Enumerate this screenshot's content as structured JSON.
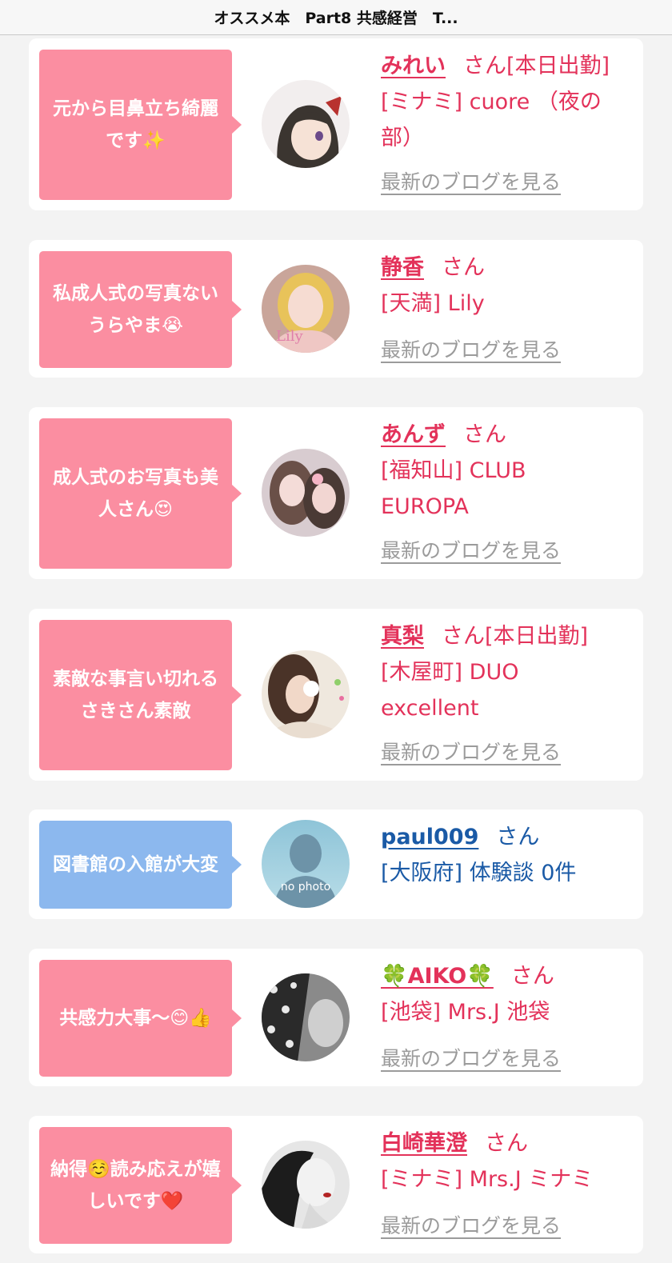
{
  "topbar": {
    "title": "オススメ本　Part8 共感経営　T..."
  },
  "entries": [
    {
      "comment": "元から目鼻立ち綺麗です✨",
      "name": "みれい",
      "san": "さん",
      "status": "[本日出勤]",
      "shop": "[ミナミ] cuore （夜の部）",
      "blog": "最新のブログを見る",
      "gender": "female"
    },
    {
      "comment": "私成人式の写真ないうらやま😭",
      "name": "静香",
      "san": "さん",
      "status": "",
      "shop": "[天満] Lily",
      "blog": "最新のブログを見る",
      "gender": "female"
    },
    {
      "comment": "成人式のお写真も美人さん😍",
      "name": "あんず",
      "san": "さん",
      "status": "",
      "shop": "[福知山] CLUB EUROPA",
      "blog": "最新のブログを見る",
      "gender": "female"
    },
    {
      "comment": "素敵な事言い切れるさきさん素敵",
      "name": "真梨",
      "san": "さん",
      "status": "[本日出勤]",
      "shop": "[木屋町] DUO excellent",
      "blog": "最新のブログを見る",
      "gender": "female"
    },
    {
      "comment": "図書館の入館が大変",
      "name": "paul009",
      "san": "さん",
      "status": "",
      "shop": "[大阪府] 体験談 0件",
      "blog": "",
      "gender": "male",
      "avatar_text": "no photo"
    },
    {
      "comment": "共感力大事〜😊👍",
      "name": "🍀AIKO🍀",
      "san": "さん",
      "status": "",
      "shop": "[池袋] Mrs.J 池袋",
      "blog": "最新のブログを見る",
      "gender": "female"
    },
    {
      "comment": "納得☺️読み応えが嬉しいです❤️",
      "name": "白崎華澄",
      "san": "さん",
      "status": "",
      "shop": "[ミナミ] Mrs.J ミナミ",
      "blog": "最新のブログを見る",
      "gender": "female"
    }
  ],
  "colors": {
    "female_bubble": "#fb8ea1",
    "male_bubble": "#8cb8ee",
    "female_text": "#e3325a",
    "male_text": "#1a5aa6",
    "blog_link": "#9b9b9b"
  }
}
